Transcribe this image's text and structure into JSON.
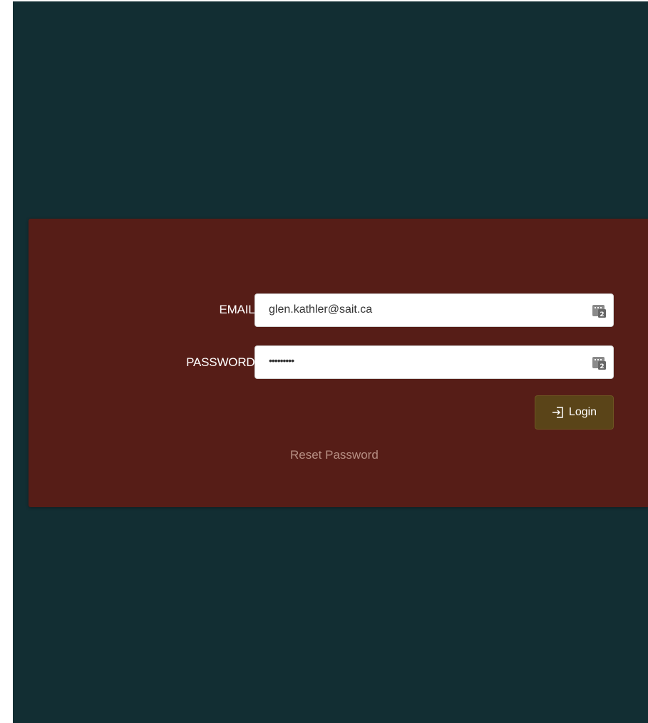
{
  "login_form": {
    "email_label": "EMAIL:",
    "email_value": "glen.kathler@sait.ca",
    "password_label": "PASSWORD:",
    "password_masked": "•••••••••",
    "login_label": "Login",
    "login_icon": "login-arrow-icon",
    "reset_password_label": "Reset Password",
    "password_manager_icon": "password-manager-icon",
    "password_manager_badge": "2"
  },
  "colors": {
    "background": "#122e33",
    "panel": "#561d17",
    "button": "#5a4418",
    "link": "#b78f84"
  }
}
